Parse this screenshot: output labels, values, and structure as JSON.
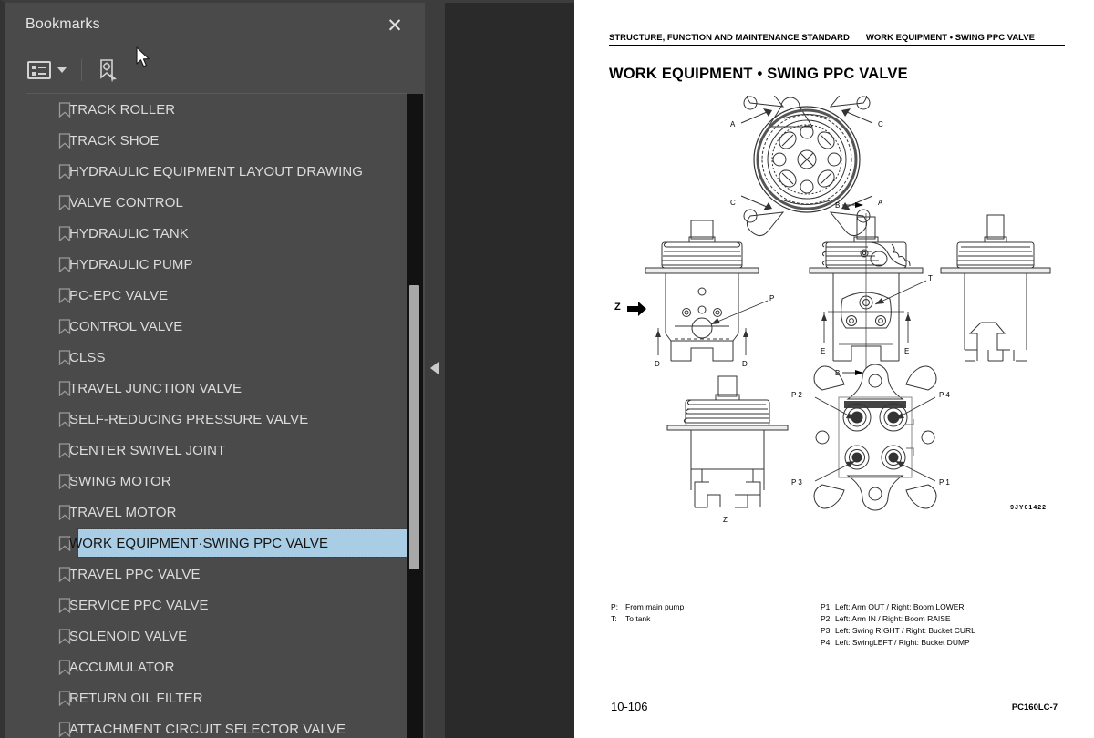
{
  "panel": {
    "title": "Bookmarks",
    "close_label": "✕",
    "toolbar": {
      "options_icon": "list-options-icon",
      "options_caret": "chevron-down-icon",
      "new_bookmark_icon": "new-bookmark-icon"
    },
    "items": [
      {
        "label": "TRACK ROLLER",
        "selected": false
      },
      {
        "label": "TRACK SHOE",
        "selected": false
      },
      {
        "label": "HYDRAULIC EQUIPMENT LAYOUT DRAWING",
        "selected": false
      },
      {
        "label": "VALVE CONTROL",
        "selected": false
      },
      {
        "label": "HYDRAULIC TANK",
        "selected": false
      },
      {
        "label": "HYDRAULIC PUMP",
        "selected": false
      },
      {
        "label": "PC-EPC VALVE",
        "selected": false
      },
      {
        "label": "CONTROL VALVE",
        "selected": false
      },
      {
        "label": "CLSS",
        "selected": false
      },
      {
        "label": "TRAVEL JUNCTION VALVE",
        "selected": false
      },
      {
        "label": "SELF-REDUCING PRESSURE VALVE",
        "selected": false
      },
      {
        "label": "CENTER SWIVEL JOINT",
        "selected": false
      },
      {
        "label": "SWING MOTOR",
        "selected": false
      },
      {
        "label": "TRAVEL MOTOR",
        "selected": false
      },
      {
        "label": "WORK EQUIPMENT·SWING PPC VALVE",
        "selected": true
      },
      {
        "label": "TRAVEL PPC VALVE",
        "selected": false
      },
      {
        "label": "SERVICE PPC VALVE",
        "selected": false
      },
      {
        "label": "SOLENOID VALVE",
        "selected": false
      },
      {
        "label": "ACCUMULATOR",
        "selected": false
      },
      {
        "label": "RETURN OIL FILTER",
        "selected": false
      },
      {
        "label": "ATTACHMENT CIRCUIT SELECTOR VALVE",
        "selected": false
      }
    ],
    "selection_color": "#a8cde4",
    "background_color": "#4a4a4a"
  },
  "collapse_handle": {
    "icon": "triangle-left-icon"
  },
  "document": {
    "running_head_left": "STRUCTURE, FUNCTION AND MAINTENANCE STANDARD",
    "running_head_right": "WORK EQUIPMENT • SWING PPC VALVE",
    "title": "WORK EQUIPMENT • SWING PPC VALVE",
    "drawing_number": "9JY01422",
    "page_number": "10-106",
    "model_number": "PC160LC-7",
    "figure_labels": {
      "section_a": "A",
      "section_b": "B",
      "section_c": "C",
      "dim_d": "D",
      "dim_e": "E",
      "view_z": "Z",
      "port_p": "P",
      "port_t": "T",
      "port_p1": "P 1",
      "port_p2": "P 2",
      "port_p3": "P 3",
      "port_p4": "P 4"
    },
    "legend_left": [
      {
        "key": "P:",
        "text": "From main pump"
      },
      {
        "key": "T:",
        "text": "To tank"
      }
    ],
    "legend_right": [
      {
        "key": "P1:",
        "text": "Left: Arm OUT / Right: Boom LOWER"
      },
      {
        "key": "P2:",
        "text": "Left: Arm IN / Right:  Boom RAISE"
      },
      {
        "key": "P3:",
        "text": "Left: Swing RIGHT / Right:  Bucket CURL"
      },
      {
        "key": "P4:",
        "text": "Left: SwingLEFT / Right: Bucket DUMP"
      }
    ]
  }
}
